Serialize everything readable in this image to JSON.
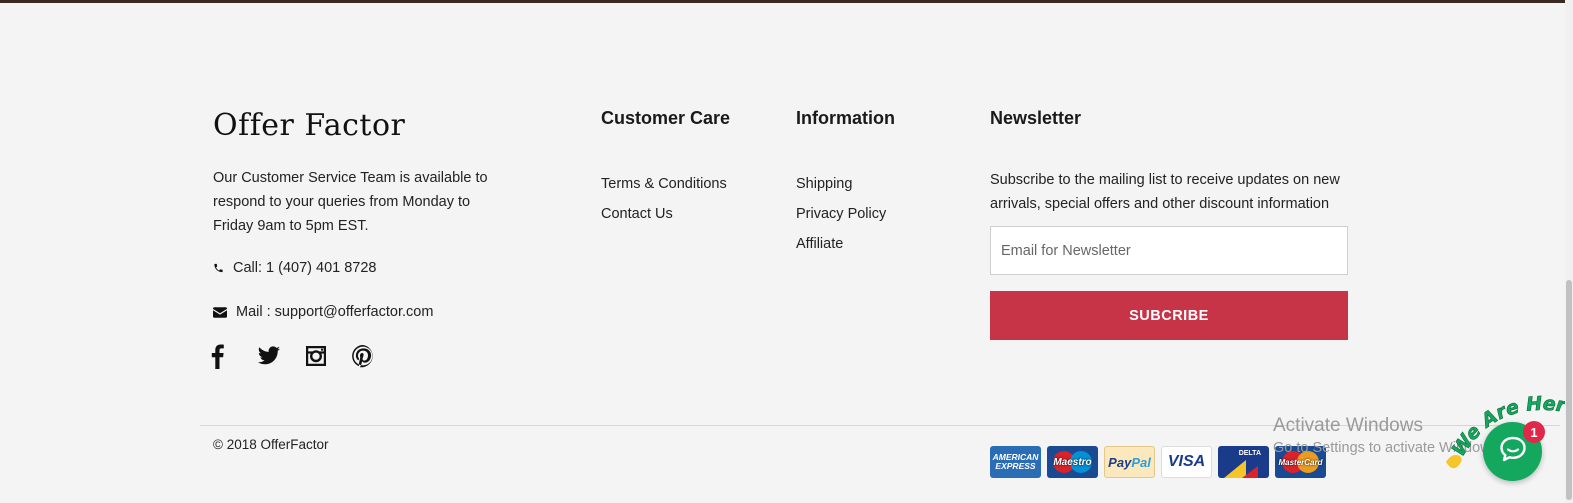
{
  "brand": {
    "logo": "Offer Factor"
  },
  "about": {
    "text": "Our Customer Service Team is available to respond to your queries from Monday to Friday 9am to 5pm EST.",
    "phone": "Call: 1 (407) 401 8728",
    "mail": "Mail : support@offerfactor.com"
  },
  "social": [
    "facebook-icon",
    "twitter-icon",
    "instagram-icon",
    "pinterest-icon"
  ],
  "customer_care": {
    "title": "Customer Care",
    "links": [
      "Terms & Conditions",
      "Contact Us"
    ]
  },
  "information": {
    "title": "Information",
    "links": [
      "Shipping",
      "Privacy Policy",
      "Affiliate"
    ]
  },
  "newsletter": {
    "title": "Newsletter",
    "text": "Subscribe to the mailing list to receive updates on new arrivals, special offers and other discount information",
    "placeholder": "Email for Newsletter",
    "button": "SUBCRIBE"
  },
  "copyright": "© 2018 OfferFactor",
  "payments": {
    "amex_line1": "AMERICAN",
    "amex_line2": "EXPRESS",
    "maestro": "Maestro",
    "paypal_a": "Pay",
    "paypal_b": "Pal",
    "visa": "VISA",
    "delta": "DELTA",
    "mastercard": "MasterCard"
  },
  "watermark": {
    "title": "Activate Windows",
    "subtitle": "Go to Settings to activate Windows."
  },
  "chat": {
    "badge_count": "1",
    "banner": "We Are Here!"
  },
  "colors": {
    "accent": "#c73447",
    "chat": "#13a85e",
    "badge": "#e0284b",
    "background": "#f4f4f4"
  }
}
